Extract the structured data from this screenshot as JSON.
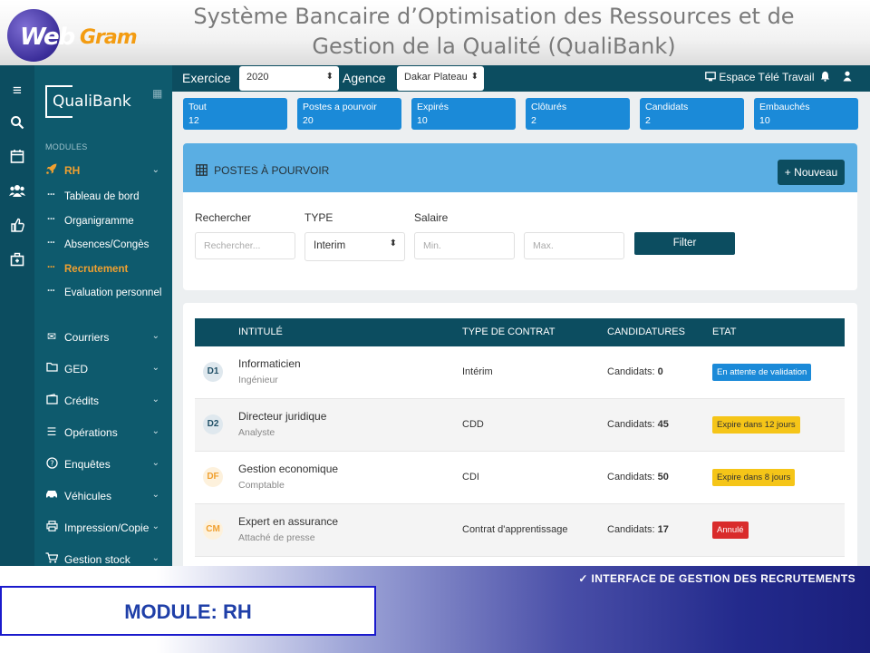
{
  "slide": {
    "brand_web": "Web",
    "brand_gram": "Gram",
    "title_line1": "Système Bancaire d’Optimisation des Ressources et de",
    "title_line2": "Gestion de la Qualité (QualiBank)"
  },
  "sidebar": {
    "brand": "QualiBank",
    "modules_label": "MODULES",
    "rh_label": "RH",
    "rh_items": [
      {
        "label": "Tableau de bord"
      },
      {
        "label": "Organigramme"
      },
      {
        "label": "Absences/Congès"
      },
      {
        "label": "Recrutement"
      },
      {
        "label": "Evaluation personnel"
      }
    ],
    "menus": [
      {
        "label": "Courriers",
        "icon": "envelope-icon"
      },
      {
        "label": "GED",
        "icon": "folder-icon"
      },
      {
        "label": "Crédits",
        "icon": "wallet-icon"
      },
      {
        "label": "Opérations",
        "icon": "list-icon"
      },
      {
        "label": "Enquêtes",
        "icon": "question-circle-icon"
      },
      {
        "label": "Véhicules",
        "icon": "car-icon"
      },
      {
        "label": "Impression/Copie",
        "icon": "printer-icon"
      },
      {
        "label": "Gestion stock",
        "icon": "cart-icon"
      }
    ]
  },
  "topbar": {
    "exercice_label": "Exercice",
    "exercice_value": "2020",
    "agence_label": "Agence",
    "agence_value": "Dakar Plateau",
    "remote_work": "Espace Télé Travail"
  },
  "stats": [
    {
      "label": "Tout",
      "value": "12"
    },
    {
      "label": "Postes a pourvoir",
      "value": "20"
    },
    {
      "label": "Expirés",
      "value": "10"
    },
    {
      "label": "Clôturés",
      "value": "2"
    },
    {
      "label": "Candidats",
      "value": "2"
    },
    {
      "label": "Embauchés",
      "value": "10"
    }
  ],
  "filters": {
    "section_title": "POSTES À POURVOIR",
    "new_button": "Nouveau",
    "search_label": "Rechercher",
    "search_placeholder": "Rechercher...",
    "type_label": "TYPE",
    "type_value": "Interim",
    "salary_label": "Salaire",
    "min_placeholder": "Min.",
    "max_placeholder": "Max.",
    "filter_button": "Filter"
  },
  "table": {
    "headers": [
      "INTITULÉ",
      "TYPE DE CONTRAT",
      "CANDIDATURES",
      "ETAT"
    ],
    "candidates_prefix": "Candidats:",
    "rows": [
      {
        "code": "D1",
        "title": "Informaticien",
        "subtitle": "Ingénieur",
        "contract": "Intérim",
        "candidates": "0",
        "state": "En attente de validation",
        "state_color": "#1b8ad8",
        "code_color": "#1f4f66"
      },
      {
        "code": "D2",
        "title": "Directeur juridique",
        "subtitle": "Analyste",
        "contract": "CDD",
        "candidates": "45",
        "state": "Expire dans 12 jours",
        "state_color": "#f5c518",
        "code_color": "#1f4f66"
      },
      {
        "code": "DF",
        "title": "Gestion economique",
        "subtitle": "Comptable",
        "contract": "CDI",
        "candidates": "50",
        "state": "Expire dans 8 jours",
        "state_color": "#f5c518",
        "code_color": "#f0a030"
      },
      {
        "code": "CM",
        "title": "Expert en assurance",
        "subtitle": "Attaché de presse",
        "contract": "Contrat d'apprentissage",
        "candidates": "17",
        "state": "Annulé",
        "state_color": "#d92b2b",
        "code_color": "#f0a030"
      }
    ]
  },
  "banner": {
    "note": "✓  INTERFACE DE GESTION DES RECRUTEMENTS",
    "module": "MODULE: RH"
  }
}
